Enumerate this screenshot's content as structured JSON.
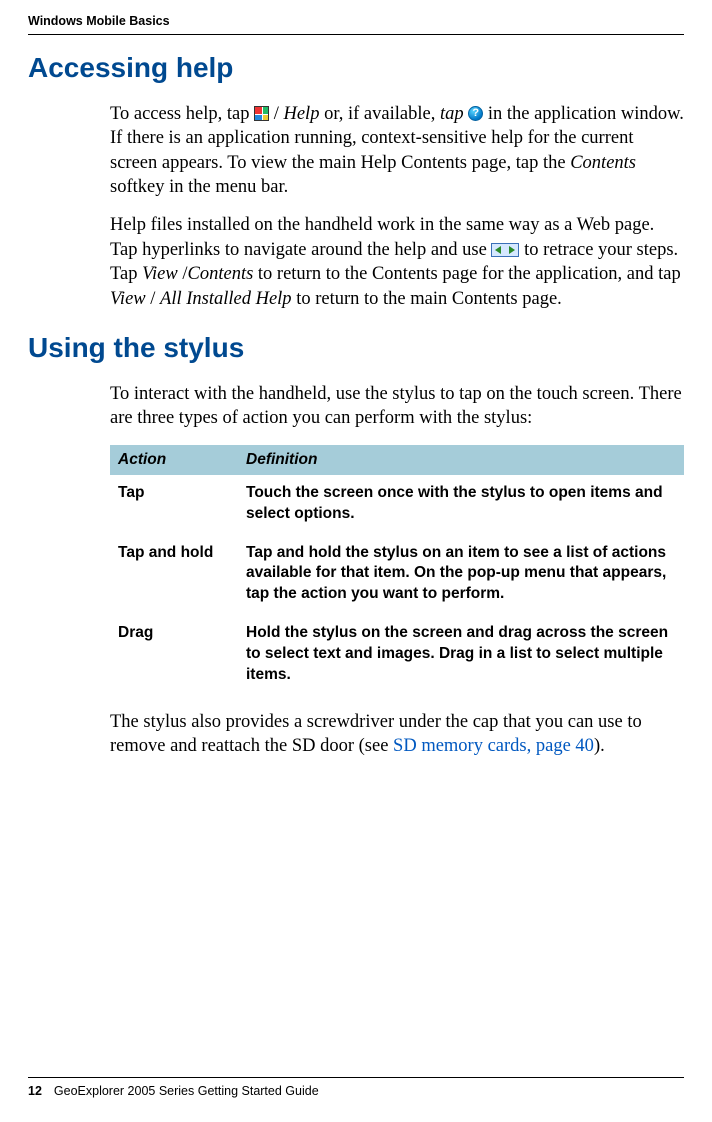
{
  "running_head": "Windows Mobile Basics",
  "h1": "Accessing help",
  "p1a": "To access help, tap ",
  "p1b": " / ",
  "p1_help": "Help",
  "p1c": " or, if available, ",
  "p1_tap": "tap",
  "p1d": " in the application window. If there is an application running, context-sensitive help for the current screen appears. To view the main Help Contents page, tap the ",
  "p1_contents": "Contents",
  "p1e": " softkey in the menu bar.",
  "p2a": "Help files installed on the handheld work in the same way as a Web page. Tap hyperlinks to navigate around the help and use ",
  "p2b": " to retrace your steps. Tap ",
  "p2_vc": "View",
  "p2_slash1": " /",
  "p2_vc2": "Contents",
  "p2c": " to return to the Contents page for the application, and tap ",
  "p2_va": "View",
  "p2_slash2": " / ",
  "p2_va2": "All Installed Help",
  "p2d": " to return to the main Contents page.",
  "h2": "Using the stylus",
  "p3": "To interact with the handheld, use the stylus to tap on the touch screen. There are three types of action you can perform with the stylus:",
  "table": {
    "headers": [
      "Action",
      "Definition"
    ],
    "rows": [
      {
        "action": "Tap",
        "def": "Touch the screen once with the stylus to open items and select options."
      },
      {
        "action": "Tap and hold",
        "def": "Tap and hold the stylus on an item to see a list of actions available for that item. On the pop-up menu that appears, tap the action you want to perform."
      },
      {
        "action": "Drag",
        "def": "Hold the stylus on the screen and drag across the screen to select text and images. Drag in a list to select multiple items."
      }
    ]
  },
  "p4a": "The stylus also provides a screwdriver under the cap that you can use to remove and reattach the SD door (see ",
  "p4_link": "SD memory cards, page 40",
  "p4b": ").",
  "footer": {
    "page_number": "12",
    "title": "GeoExplorer 2005 Series Getting Started Guide"
  }
}
